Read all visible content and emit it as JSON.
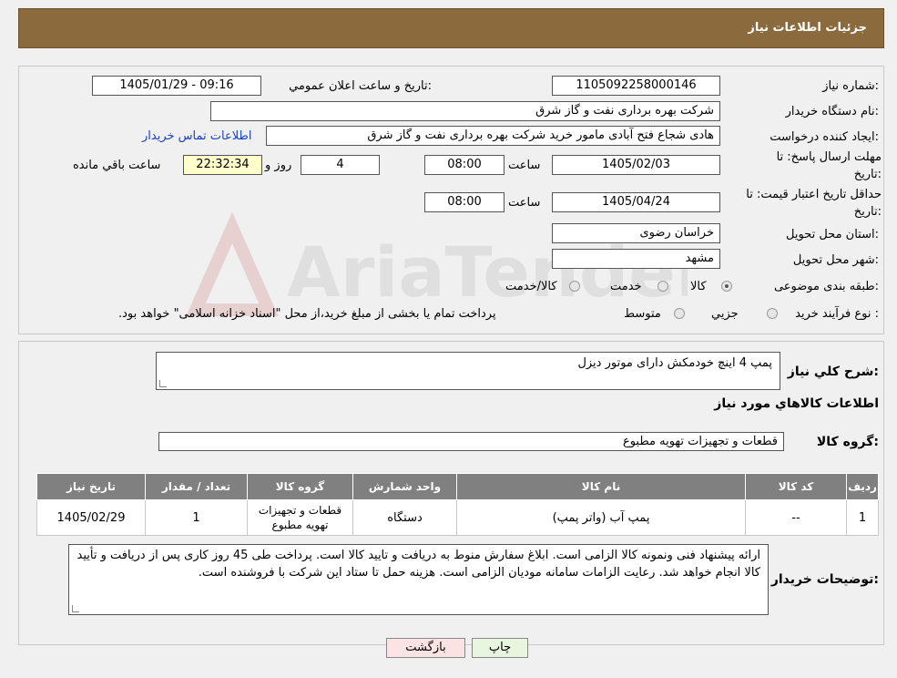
{
  "header": {
    "title": "جزئیات اطلاعات نیاز"
  },
  "form": {
    "need_number": {
      "label": "شماره نیاز:",
      "value": "1105092258000146"
    },
    "announce": {
      "label": "تاریخ و ساعت اعلان عمومي:",
      "value": "1405/01/29 - 09:16"
    },
    "buyer_org": {
      "label": "نام دستگاه خریدار:",
      "value": "شرکت بهره برداری نفت و گاز شرق"
    },
    "requester": {
      "label": "ایجاد کننده درخواست:",
      "value": "هادی شجاع فتح آبادی مامور خرید شرکت بهره برداری نفت و گاز شرق",
      "contact_link": "اطلاعات تماس خریدار"
    },
    "reply_deadline": {
      "label_line1": "مهلت ارسال پاسخ: تا",
      "label_line2": "تاریخ:",
      "date": "1405/02/03",
      "time_label": "ساعت",
      "time": "08:00",
      "days": "4",
      "days_label": "روز و",
      "remaining": "22:32:34",
      "remaining_label": "ساعت باقي مانده"
    },
    "price_validity": {
      "label_line1": "حداقل تاریخ اعتبار قیمت: تا",
      "label_line2": "تاریخ:",
      "date": "1405/04/24",
      "time_label": "ساعت",
      "time": "08:00"
    },
    "province": {
      "label": "استان محل تحویل:",
      "value": "خراسان رضوی"
    },
    "city": {
      "label": "شهر محل تحویل:",
      "value": "مشهد"
    },
    "category": {
      "label": "طبقه بندی موضوعی:",
      "options": [
        "کالا",
        "خدمت",
        "کالا/خدمت"
      ],
      "selected": "کالا"
    },
    "process": {
      "label": "نوع فرآیند خرید :",
      "options": [
        "جزيي",
        "متوسط"
      ],
      "note": "پرداخت تمام یا بخشی از مبلغ خرید،از محل \"اسناد خزانه اسلامی\" خواهد بود."
    }
  },
  "summary": {
    "label": "شرح کلي نياز:",
    "value": "پمپ 4 اینچ خودمکش دارای موتور دیزل",
    "goods_info_title": "اطلاعات کالاهاي مورد نياز",
    "group_label": "گروه کالا:",
    "group_value": "قطعات و تجهیزات تهویه مطبوع"
  },
  "table": {
    "headers": [
      "رديف",
      "کد کالا",
      "نام کالا",
      "واحد شمارش",
      "گروه کالا",
      "تعداد / مقدار",
      "تاریخ نیاز"
    ],
    "rows": [
      [
        "1",
        "--",
        "پمپ آب (واتر پمپ)",
        "دستگاه",
        "قطعات و تجهیزات تهویه مطبوع",
        "1",
        "1405/02/29"
      ]
    ]
  },
  "buyer_notes": {
    "label": "توضیحات خریدار:",
    "value": "ارائه پیشنهاد فنی ونمونه کالا الزامی است. ابلاغ سفارش منوط به دریافت و تایید کالا است. پرداخت طی  45 روز کاری پس از دریافت و تأیید کالا انجام خواهد شد. رعایت الزامات سامانه مودیان الزامی است. هزینه حمل تا ستاد این شرکت با فروشنده است."
  },
  "buttons": {
    "print": "چاپ",
    "back": "بازگشت"
  },
  "watermark": {
    "text": "AriaTender.neT"
  },
  "colors": {
    "header": "#8b6b3d",
    "link": "#1a3fc0",
    "table_header": "#808080",
    "back_button": "#fbe3e3",
    "print_button": "#e8f6e0",
    "remaining_bg": "#ffffcc"
  }
}
